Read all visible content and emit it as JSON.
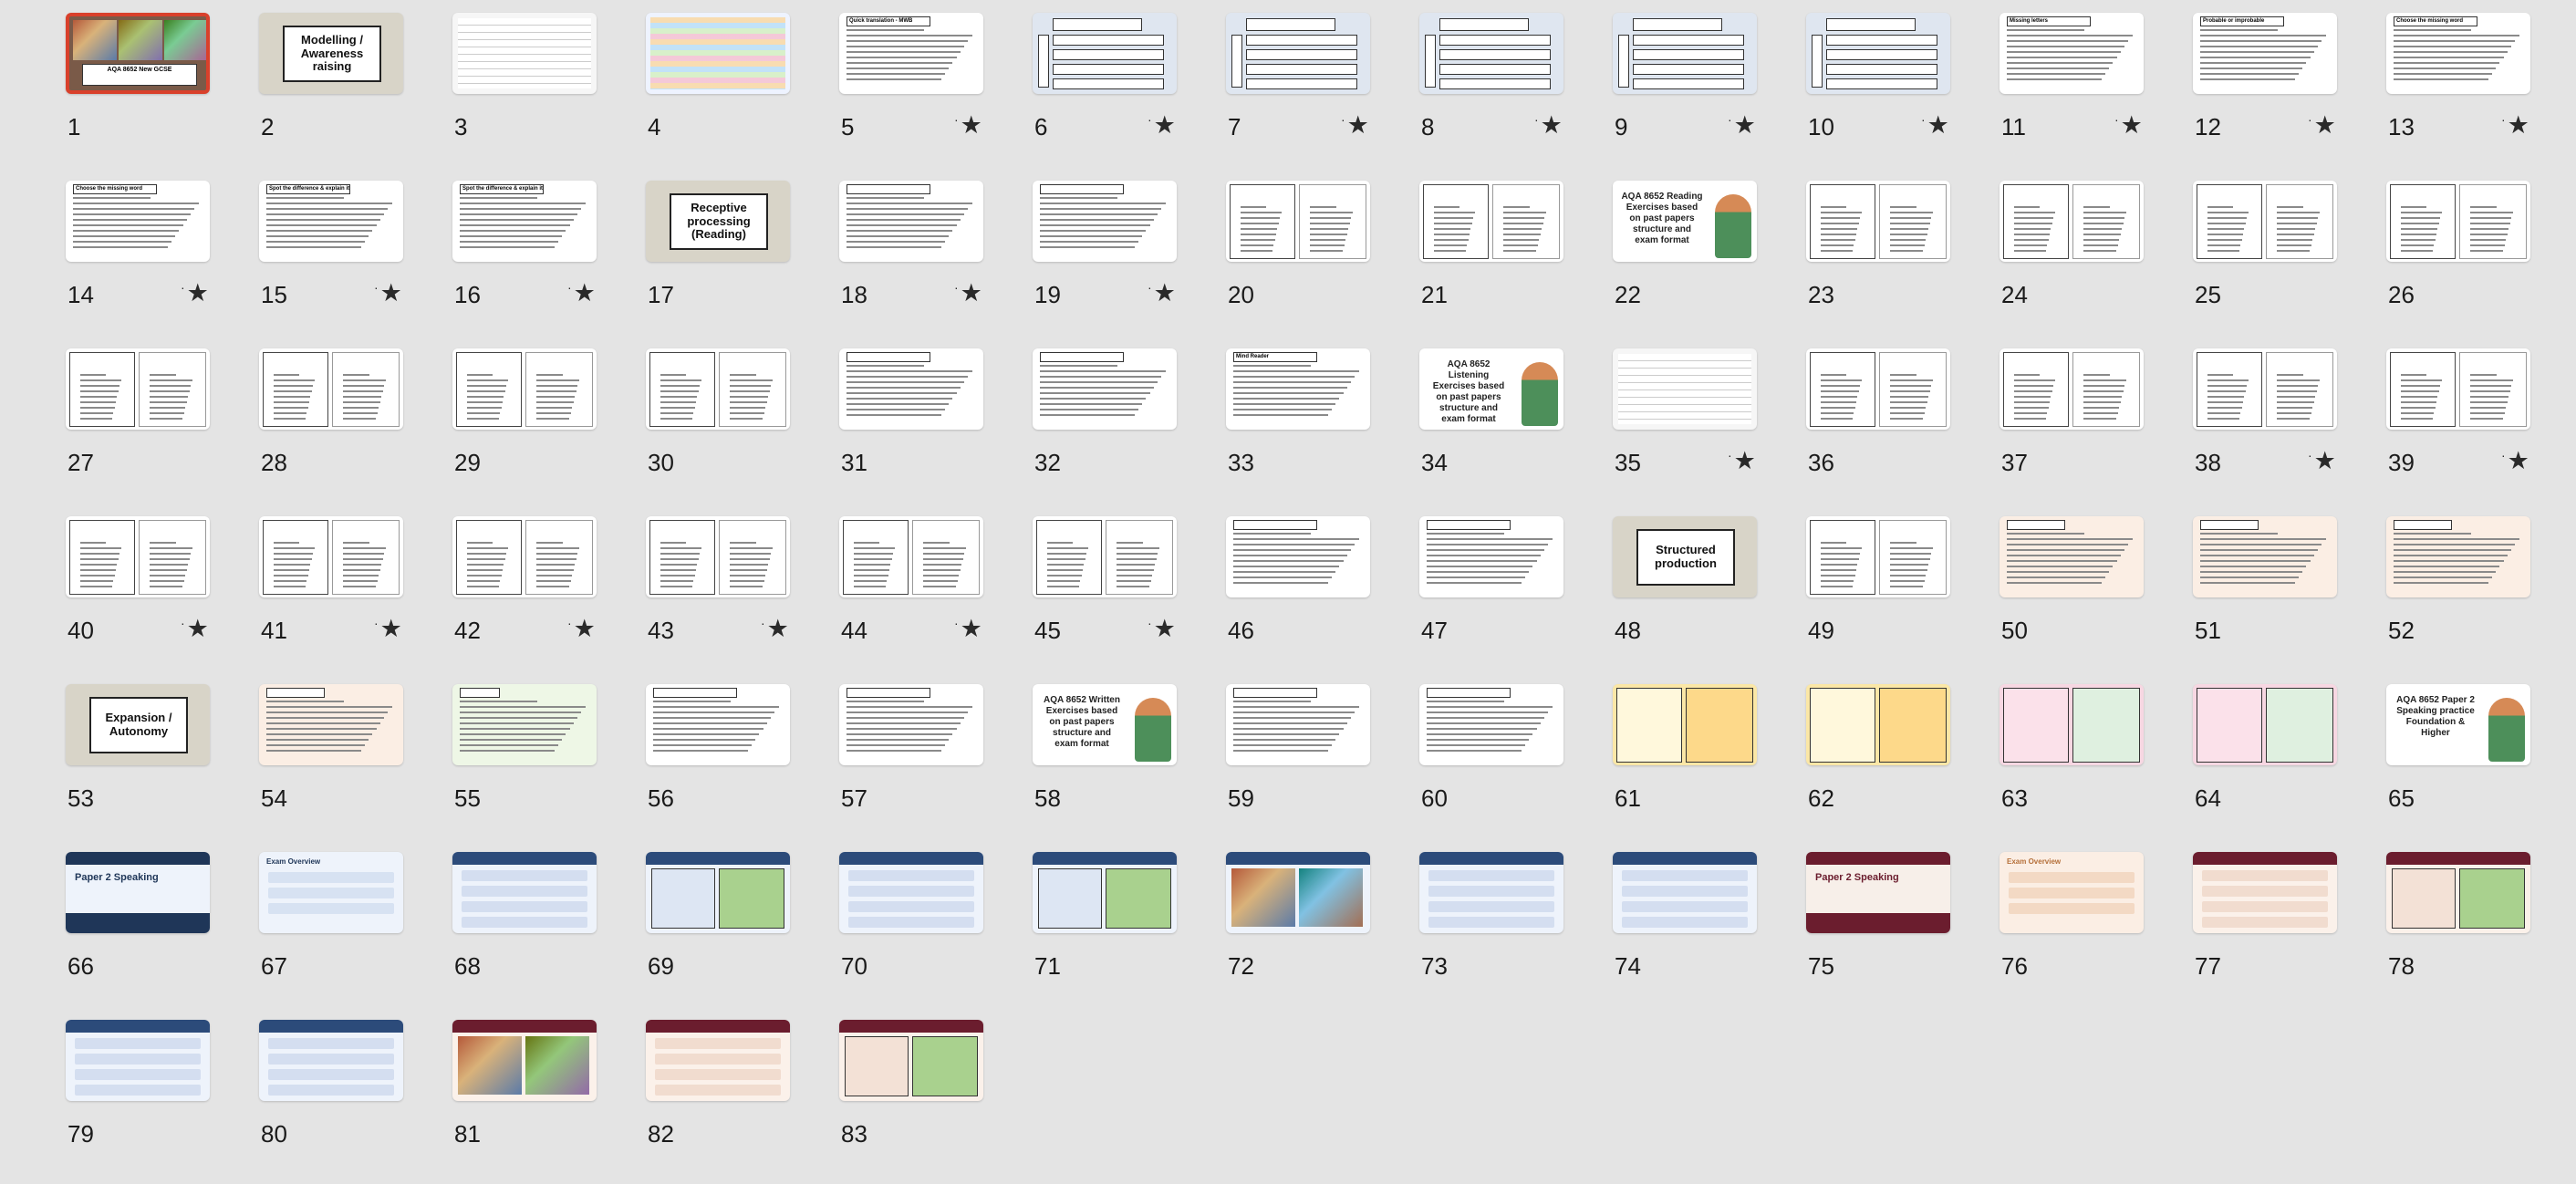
{
  "app": {
    "view": "slide-sorter",
    "selected_slide": "1"
  },
  "colors": {
    "selection_border": "#d9402b",
    "background": "#e4e4e4",
    "number_text": "#1a1a1a"
  },
  "icons": {
    "transition_marker": "star-transition-icon"
  },
  "slides": [
    {
      "number": "1",
      "has_star": false,
      "style": "photo",
      "caption": "AQA 8652 New GCSE",
      "selected": true
    },
    {
      "number": "2",
      "has_star": false,
      "style": "title",
      "label": "Modelling / Awareness raising"
    },
    {
      "number": "3",
      "has_star": false,
      "style": "table"
    },
    {
      "number": "4",
      "has_star": false,
      "style": "colorful"
    },
    {
      "number": "5",
      "has_star": true,
      "style": "text",
      "header": "Quick translation - MWB"
    },
    {
      "number": "6",
      "has_star": true,
      "style": "boxes"
    },
    {
      "number": "7",
      "has_star": true,
      "style": "boxes"
    },
    {
      "number": "8",
      "has_star": true,
      "style": "boxes"
    },
    {
      "number": "9",
      "has_star": true,
      "style": "boxes"
    },
    {
      "number": "10",
      "has_star": true,
      "style": "boxes"
    },
    {
      "number": "11",
      "has_star": true,
      "style": "text",
      "header": "Missing letters"
    },
    {
      "number": "12",
      "has_star": true,
      "style": "text",
      "header": "Probable or improbable"
    },
    {
      "number": "13",
      "has_star": true,
      "style": "text",
      "header": "Choose the missing word"
    },
    {
      "number": "14",
      "has_star": true,
      "style": "text",
      "header": "Choose the missing word"
    },
    {
      "number": "15",
      "has_star": true,
      "style": "text",
      "header": "Spot the difference & explain it to your partner"
    },
    {
      "number": "16",
      "has_star": true,
      "style": "text",
      "header": "Spot the difference & explain it to your partner"
    },
    {
      "number": "17",
      "has_star": false,
      "style": "title",
      "label": "Receptive processing (Reading)"
    },
    {
      "number": "18",
      "has_star": true,
      "style": "text",
      "header": ""
    },
    {
      "number": "19",
      "has_star": true,
      "style": "text",
      "header": ""
    },
    {
      "number": "20",
      "has_star": false,
      "style": "two-col"
    },
    {
      "number": "21",
      "has_star": false,
      "style": "two-col"
    },
    {
      "number": "22",
      "has_star": false,
      "style": "avatar",
      "label": "AQA 8652 Reading Exercises based on past papers structure and exam format"
    },
    {
      "number": "23",
      "has_star": false,
      "style": "two-col"
    },
    {
      "number": "24",
      "has_star": false,
      "style": "two-col"
    },
    {
      "number": "25",
      "has_star": false,
      "style": "two-col"
    },
    {
      "number": "26",
      "has_star": false,
      "style": "two-col"
    },
    {
      "number": "27",
      "has_star": false,
      "style": "two-col"
    },
    {
      "number": "28",
      "has_star": false,
      "style": "two-col"
    },
    {
      "number": "29",
      "has_star": false,
      "style": "two-col"
    },
    {
      "number": "30",
      "has_star": false,
      "style": "two-col"
    },
    {
      "number": "31",
      "has_star": false,
      "style": "text",
      "header": ""
    },
    {
      "number": "32",
      "has_star": false,
      "style": "text",
      "header": ""
    },
    {
      "number": "33",
      "has_star": false,
      "style": "text",
      "header": "Mind Reader"
    },
    {
      "number": "34",
      "has_star": false,
      "style": "avatar",
      "label": "AQA 8652 Listening Exercises based on past papers structure and exam format"
    },
    {
      "number": "35",
      "has_star": true,
      "style": "table"
    },
    {
      "number": "36",
      "has_star": false,
      "style": "two-col"
    },
    {
      "number": "37",
      "has_star": false,
      "style": "two-col"
    },
    {
      "number": "38",
      "has_star": true,
      "style": "two-col"
    },
    {
      "number": "39",
      "has_star": true,
      "style": "two-col"
    },
    {
      "number": "40",
      "has_star": true,
      "style": "two-col"
    },
    {
      "number": "41",
      "has_star": true,
      "style": "two-col"
    },
    {
      "number": "42",
      "has_star": true,
      "style": "two-col"
    },
    {
      "number": "43",
      "has_star": true,
      "style": "two-col"
    },
    {
      "number": "44",
      "has_star": true,
      "style": "two-col"
    },
    {
      "number": "45",
      "has_star": true,
      "style": "two-col"
    },
    {
      "number": "46",
      "has_star": false,
      "style": "text",
      "header": ""
    },
    {
      "number": "47",
      "has_star": false,
      "style": "text",
      "header": ""
    },
    {
      "number": "48",
      "has_star": false,
      "style": "title",
      "label": "Structured production"
    },
    {
      "number": "49",
      "has_star": false,
      "style": "two-col"
    },
    {
      "number": "50",
      "has_star": false,
      "style": "table-peach"
    },
    {
      "number": "51",
      "has_star": false,
      "style": "table-peach"
    },
    {
      "number": "52",
      "has_star": false,
      "style": "table-peach"
    },
    {
      "number": "53",
      "has_star": false,
      "style": "title",
      "label": "Expansion / Autonomy"
    },
    {
      "number": "54",
      "has_star": false,
      "style": "table-peach"
    },
    {
      "number": "55",
      "has_star": false,
      "style": "table-green"
    },
    {
      "number": "56",
      "has_star": false,
      "style": "text",
      "header": ""
    },
    {
      "number": "57",
      "has_star": false,
      "style": "text",
      "header": ""
    },
    {
      "number": "58",
      "has_star": false,
      "style": "avatar",
      "label": "AQA 8652 Written Exercises based on past papers structure and exam format"
    },
    {
      "number": "59",
      "has_star": false,
      "style": "text",
      "header": ""
    },
    {
      "number": "60",
      "has_star": false,
      "style": "text",
      "header": ""
    },
    {
      "number": "61",
      "has_star": false,
      "style": "yellow"
    },
    {
      "number": "62",
      "has_star": false,
      "style": "yellow"
    },
    {
      "number": "63",
      "has_star": false,
      "style": "pink"
    },
    {
      "number": "64",
      "has_star": false,
      "style": "pink"
    },
    {
      "number": "65",
      "has_star": false,
      "style": "avatar",
      "label": "AQA 8652 Paper 2 Speaking practice Foundation & Higher"
    },
    {
      "number": "66",
      "has_star": false,
      "style": "navy-title",
      "label": "Paper 2 Speaking"
    },
    {
      "number": "67",
      "has_star": false,
      "style": "overview",
      "label": "Exam Overview"
    },
    {
      "number": "68",
      "has_star": false,
      "style": "blue-card"
    },
    {
      "number": "69",
      "has_star": false,
      "style": "blue-green"
    },
    {
      "number": "70",
      "has_star": false,
      "style": "blue-card"
    },
    {
      "number": "71",
      "has_star": false,
      "style": "blue-green"
    },
    {
      "number": "72",
      "has_star": false,
      "style": "blue-photo"
    },
    {
      "number": "73",
      "has_star": false,
      "style": "blue-card"
    },
    {
      "number": "74",
      "has_star": false,
      "style": "blue-card"
    },
    {
      "number": "75",
      "has_star": false,
      "style": "maroon-title",
      "label": "Paper 2 Speaking"
    },
    {
      "number": "76",
      "has_star": false,
      "style": "overview-peach",
      "label": "Exam Overview"
    },
    {
      "number": "77",
      "has_star": false,
      "style": "maroon-card"
    },
    {
      "number": "78",
      "has_star": false,
      "style": "maroon-green"
    },
    {
      "number": "79",
      "has_star": false,
      "style": "blue-card"
    },
    {
      "number": "80",
      "has_star": false,
      "style": "blue-card"
    },
    {
      "number": "81",
      "has_star": false,
      "style": "maroon-photo"
    },
    {
      "number": "82",
      "has_star": false,
      "style": "maroon-card"
    },
    {
      "number": "83",
      "has_star": false,
      "style": "maroon-green"
    }
  ]
}
